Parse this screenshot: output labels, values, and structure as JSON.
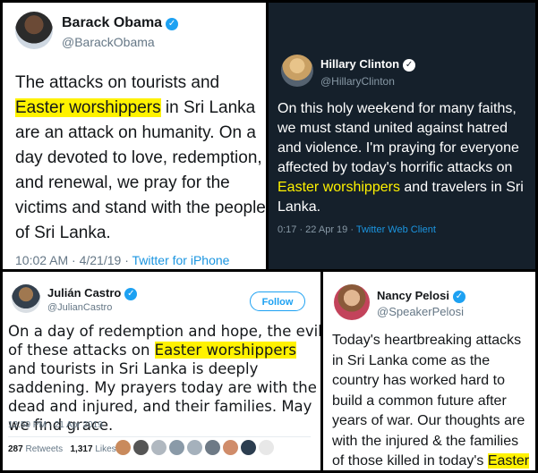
{
  "obama": {
    "name": "Barack Obama",
    "handle": "@BarackObama",
    "text_before": "The attacks on tourists and ",
    "highlight": "Easter worshippers",
    "text_after": " in Sri Lanka are an attack on humanity. On a day devoted to love, redemption, and renewal, we pray for the victims and stand with the people of Sri Lanka.",
    "timestamp": "10:02 AM · 4/21/19 · ",
    "source": "Twitter for iPhone"
  },
  "clinton": {
    "name": "Hillary Clinton",
    "handle": "@HillaryClinton",
    "text_before": "On this holy weekend for many faiths, we must stand united against hatred and violence. I'm praying for everyone affected by today's horrific attacks on ",
    "highlight": "Easter worshippers",
    "text_after": " and travelers in Sri Lanka.",
    "timestamp": "0:17 · 22 Apr 19 · ",
    "source": "Twitter Web Client"
  },
  "castro": {
    "name": "Julián Castro",
    "handle": "@JulianCastro",
    "follow_label": "Follow",
    "text_before": "On a day of redemption and hope, the evil of these attacks on ",
    "highlight": "Easter worshippers",
    "text_after": " and tourists in Sri Lanka is deeply saddening. My prayers today are with the dead and injured, and their families. May we find grace.",
    "timestamp": "12:59 PM - 21 Apr 2019",
    "retweets_count": "287",
    "retweets_label": "Retweets",
    "likes_count": "1,317",
    "likes_label": "Likes"
  },
  "pelosi": {
    "name": "Nancy Pelosi",
    "handle": "@SpeakerPelosi",
    "text_before": "Today's heartbreaking attacks in Sri Lanka come as the country has worked hard to build a common future after years of war. Our thoughts are with the injured & the families of those killed in today's ",
    "highlight": "Easter Sunday attacks."
  },
  "colors": {
    "highlight": "#fff200",
    "twitter_blue": "#1da1f2",
    "dark_bg": "#15202b"
  }
}
